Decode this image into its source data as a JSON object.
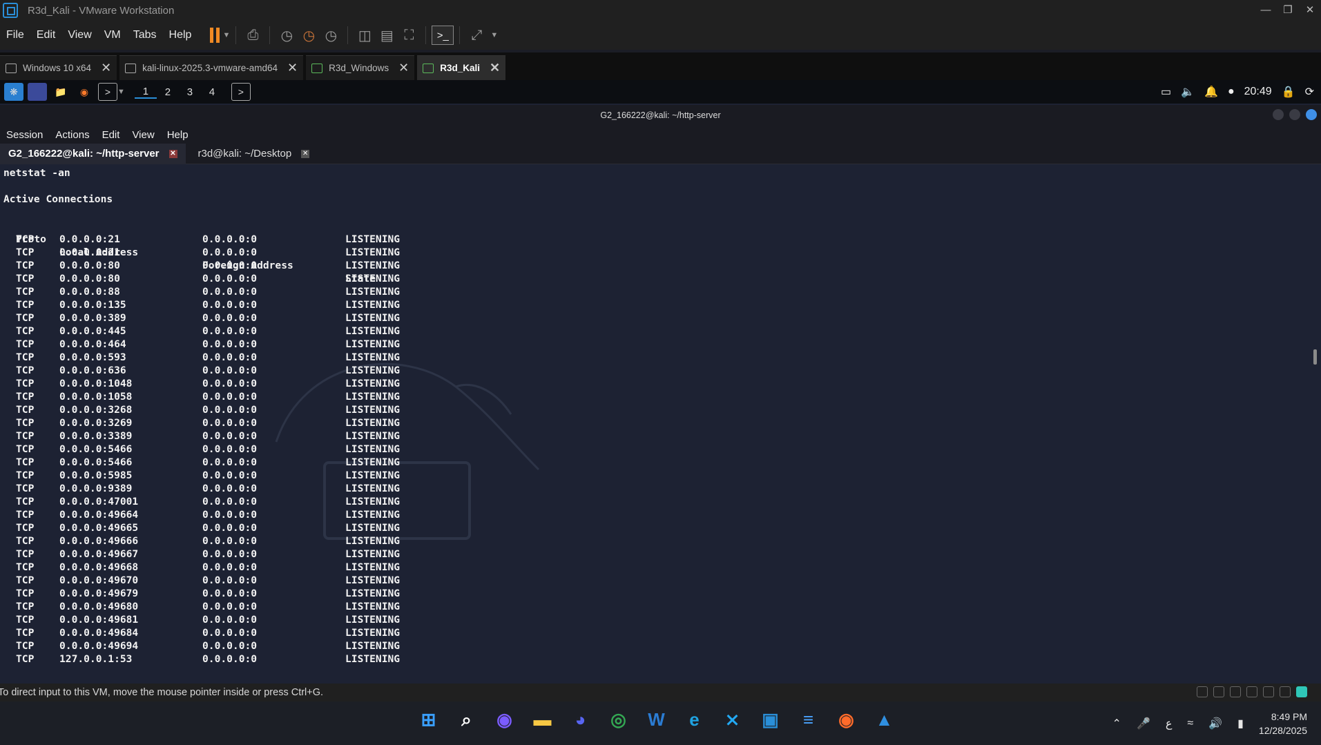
{
  "vmware": {
    "title": "R3d_Kali - VMware Workstation",
    "menus": [
      "File",
      "Edit",
      "View",
      "VM",
      "Tabs",
      "Help"
    ],
    "tabs": [
      {
        "label": "Windows 10 x64",
        "active": false
      },
      {
        "label": "kali-linux-2025.3-vmware-amd64",
        "active": false
      },
      {
        "label": "R3d_Windows",
        "active": false
      },
      {
        "label": "R3d_Kali",
        "active": true
      }
    ],
    "status_message": "To direct input to this VM, move the mouse pointer inside or press Ctrl+G."
  },
  "xfce_panel": {
    "workspaces": [
      "1",
      "2",
      "3",
      "4"
    ],
    "time": "20:49"
  },
  "terminal": {
    "title": "G2_166222@kali: ~/http-server",
    "menus": [
      "Session",
      "Actions",
      "Edit",
      "View",
      "Help"
    ],
    "tabs": [
      {
        "label": "G2_166222@kali: ~/http-server",
        "active": true
      },
      {
        "label": "r3d@kali: ~/Desktop",
        "active": false
      }
    ],
    "command": "netstat -an",
    "heading": "Active Connections",
    "columns": {
      "proto": "Proto",
      "local": "Local Address",
      "foreign": "Foreign Address",
      "state": "State"
    },
    "rows": [
      [
        "TCP",
        "0.0.0.0:21",
        "0.0.0.0:0",
        "LISTENING"
      ],
      [
        "TCP",
        "0.0.0.0:21",
        "0.0.0.0:0",
        "LISTENING"
      ],
      [
        "TCP",
        "0.0.0.0:80",
        "0.0.0.0:0",
        "LISTENING"
      ],
      [
        "TCP",
        "0.0.0.0:80",
        "0.0.0.0:0",
        "LISTENING"
      ],
      [
        "TCP",
        "0.0.0.0:88",
        "0.0.0.0:0",
        "LISTENING"
      ],
      [
        "TCP",
        "0.0.0.0:135",
        "0.0.0.0:0",
        "LISTENING"
      ],
      [
        "TCP",
        "0.0.0.0:389",
        "0.0.0.0:0",
        "LISTENING"
      ],
      [
        "TCP",
        "0.0.0.0:445",
        "0.0.0.0:0",
        "LISTENING"
      ],
      [
        "TCP",
        "0.0.0.0:464",
        "0.0.0.0:0",
        "LISTENING"
      ],
      [
        "TCP",
        "0.0.0.0:593",
        "0.0.0.0:0",
        "LISTENING"
      ],
      [
        "TCP",
        "0.0.0.0:636",
        "0.0.0.0:0",
        "LISTENING"
      ],
      [
        "TCP",
        "0.0.0.0:1048",
        "0.0.0.0:0",
        "LISTENING"
      ],
      [
        "TCP",
        "0.0.0.0:1058",
        "0.0.0.0:0",
        "LISTENING"
      ],
      [
        "TCP",
        "0.0.0.0:3268",
        "0.0.0.0:0",
        "LISTENING"
      ],
      [
        "TCP",
        "0.0.0.0:3269",
        "0.0.0.0:0",
        "LISTENING"
      ],
      [
        "TCP",
        "0.0.0.0:3389",
        "0.0.0.0:0",
        "LISTENING"
      ],
      [
        "TCP",
        "0.0.0.0:5466",
        "0.0.0.0:0",
        "LISTENING"
      ],
      [
        "TCP",
        "0.0.0.0:5466",
        "0.0.0.0:0",
        "LISTENING"
      ],
      [
        "TCP",
        "0.0.0.0:5985",
        "0.0.0.0:0",
        "LISTENING"
      ],
      [
        "TCP",
        "0.0.0.0:9389",
        "0.0.0.0:0",
        "LISTENING"
      ],
      [
        "TCP",
        "0.0.0.0:47001",
        "0.0.0.0:0",
        "LISTENING"
      ],
      [
        "TCP",
        "0.0.0.0:49664",
        "0.0.0.0:0",
        "LISTENING"
      ],
      [
        "TCP",
        "0.0.0.0:49665",
        "0.0.0.0:0",
        "LISTENING"
      ],
      [
        "TCP",
        "0.0.0.0:49666",
        "0.0.0.0:0",
        "LISTENING"
      ],
      [
        "TCP",
        "0.0.0.0:49667",
        "0.0.0.0:0",
        "LISTENING"
      ],
      [
        "TCP",
        "0.0.0.0:49668",
        "0.0.0.0:0",
        "LISTENING"
      ],
      [
        "TCP",
        "0.0.0.0:49670",
        "0.0.0.0:0",
        "LISTENING"
      ],
      [
        "TCP",
        "0.0.0.0:49679",
        "0.0.0.0:0",
        "LISTENING"
      ],
      [
        "TCP",
        "0.0.0.0:49680",
        "0.0.0.0:0",
        "LISTENING"
      ],
      [
        "TCP",
        "0.0.0.0:49681",
        "0.0.0.0:0",
        "LISTENING"
      ],
      [
        "TCP",
        "0.0.0.0:49684",
        "0.0.0.0:0",
        "LISTENING"
      ],
      [
        "TCP",
        "0.0.0.0:49694",
        "0.0.0.0:0",
        "LISTENING"
      ],
      [
        "TCP",
        "127.0.0.1:53",
        "0.0.0.0:0",
        "LISTENING"
      ]
    ]
  },
  "taskbar": {
    "apps": [
      {
        "icon": "windows-start-icon",
        "color": "#3aa0ff"
      },
      {
        "icon": "search-icon",
        "color": "#ffffff"
      },
      {
        "icon": "proton-icon",
        "color": "#7b5cff"
      },
      {
        "icon": "file-explorer-icon",
        "color": "#f7c844"
      },
      {
        "icon": "discord-icon",
        "color": "#5865f2"
      },
      {
        "icon": "chrome-icon",
        "color": "#34a853"
      },
      {
        "icon": "word-icon",
        "color": "#2b7cd3"
      },
      {
        "icon": "edge-icon",
        "color": "#1fa2e0"
      },
      {
        "icon": "vscode-icon",
        "color": "#23a9f2"
      },
      {
        "icon": "vmware-icon",
        "color": "#2a8fd8"
      },
      {
        "icon": "notepad-icon",
        "color": "#4aa3ff"
      },
      {
        "icon": "firefox-icon",
        "color": "#ff6b2a"
      },
      {
        "icon": "photos-icon",
        "color": "#2f8fe0"
      }
    ],
    "ime": "ع",
    "time": "8:49 PM",
    "date": "12/28/2025"
  }
}
